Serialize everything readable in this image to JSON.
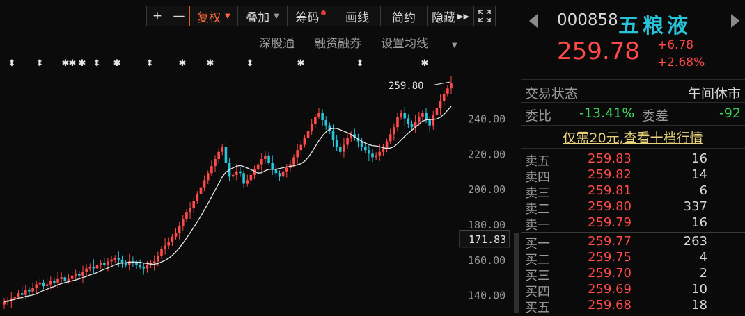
{
  "toolbar": {
    "plus": "+",
    "minus": "—",
    "fuquan": "复权",
    "diejia": "叠加",
    "chouma": "筹码",
    "huaxian": "画线",
    "jianyue": "简约",
    "yincang": "隐藏",
    "expand_icon": "expand-icon"
  },
  "subbar": {
    "shengutong": "深股通",
    "rongzi": "融资融券",
    "junxian": "设置均线"
  },
  "chart_data": {
    "type": "candlestick",
    "y_ticks": [
      "240.00",
      "220.00",
      "200.00",
      "180.00",
      "160.00",
      "140.00"
    ],
    "ylim": [
      132,
      263
    ],
    "crosshair_label": "171.83",
    "annotation": "259.80",
    "closes": [
      136,
      137,
      138,
      139,
      141,
      140,
      143,
      142,
      144,
      146,
      147,
      145,
      146,
      148,
      147,
      149,
      150,
      148,
      149,
      151,
      152,
      151,
      153,
      155,
      156,
      155,
      157,
      158,
      157,
      159,
      160,
      161,
      160,
      158,
      157,
      159,
      158,
      157,
      156,
      155,
      157,
      158,
      159,
      162,
      166,
      168,
      170,
      173,
      175,
      179,
      183,
      187,
      189,
      193,
      197,
      201,
      205,
      209,
      213,
      217,
      221,
      224,
      215,
      207,
      208,
      210,
      209,
      203,
      205,
      208,
      211,
      214,
      217,
      219,
      215,
      211,
      209,
      207,
      210,
      212,
      214,
      218,
      222,
      225,
      229,
      233,
      237,
      241,
      243,
      239,
      236,
      233,
      228,
      224,
      221,
      225,
      229,
      231,
      229,
      227,
      224,
      222,
      220,
      218,
      219,
      221,
      223,
      227,
      231,
      235,
      241,
      243,
      240,
      237,
      235,
      238,
      241,
      243,
      239,
      236,
      242,
      246,
      250,
      254,
      257,
      259.78
    ],
    "markers": [
      17,
      57,
      94,
      104,
      118,
      139,
      168,
      215,
      262,
      302,
      359,
      432,
      517,
      610
    ]
  },
  "quote": {
    "code": "000858",
    "name": "五粮液",
    "price": "259.78",
    "change": "+6.78",
    "change_pct": "+2.68%",
    "status_label": "交易状态",
    "status_value": "午间休市",
    "weibi_label": "委比",
    "weibi_value": "-13.41%",
    "weicha_label": "委差",
    "weicha_value": "-92",
    "promo": "仅需20元,查看十档行情"
  },
  "orderbook": {
    "asks": [
      {
        "label": "卖五",
        "price": "259.83",
        "vol": "16"
      },
      {
        "label": "卖四",
        "price": "259.82",
        "vol": "14"
      },
      {
        "label": "卖三",
        "price": "259.81",
        "vol": "6"
      },
      {
        "label": "卖二",
        "price": "259.80",
        "vol": "337"
      },
      {
        "label": "卖一",
        "price": "259.79",
        "vol": "16"
      }
    ],
    "bids": [
      {
        "label": "买一",
        "price": "259.77",
        "vol": "263"
      },
      {
        "label": "买二",
        "price": "259.75",
        "vol": "4"
      },
      {
        "label": "买三",
        "price": "259.70",
        "vol": "2"
      },
      {
        "label": "买四",
        "price": "259.69",
        "vol": "10"
      },
      {
        "label": "买五",
        "price": "259.68",
        "vol": "18"
      }
    ]
  },
  "colors": {
    "up": "#ff4a4a",
    "down": "#27c3d9",
    "name": "#27c3d9",
    "promo": "#e8d37a",
    "weibi": "#3cd35a"
  }
}
